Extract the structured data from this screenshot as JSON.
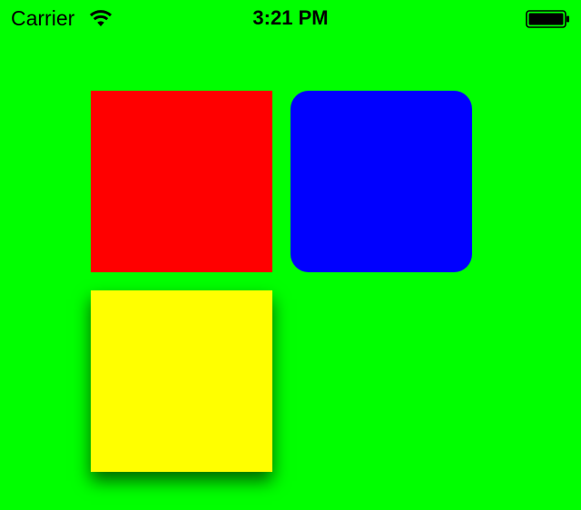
{
  "status_bar": {
    "carrier": "Carrier",
    "time": "3:21 PM",
    "icons": [
      "wifi-icon",
      "battery-icon"
    ]
  },
  "colors": {
    "background": "#00ff00",
    "red_square": "#ff0000",
    "blue_square": "#0000ff",
    "yellow_square": "#ffff00"
  }
}
